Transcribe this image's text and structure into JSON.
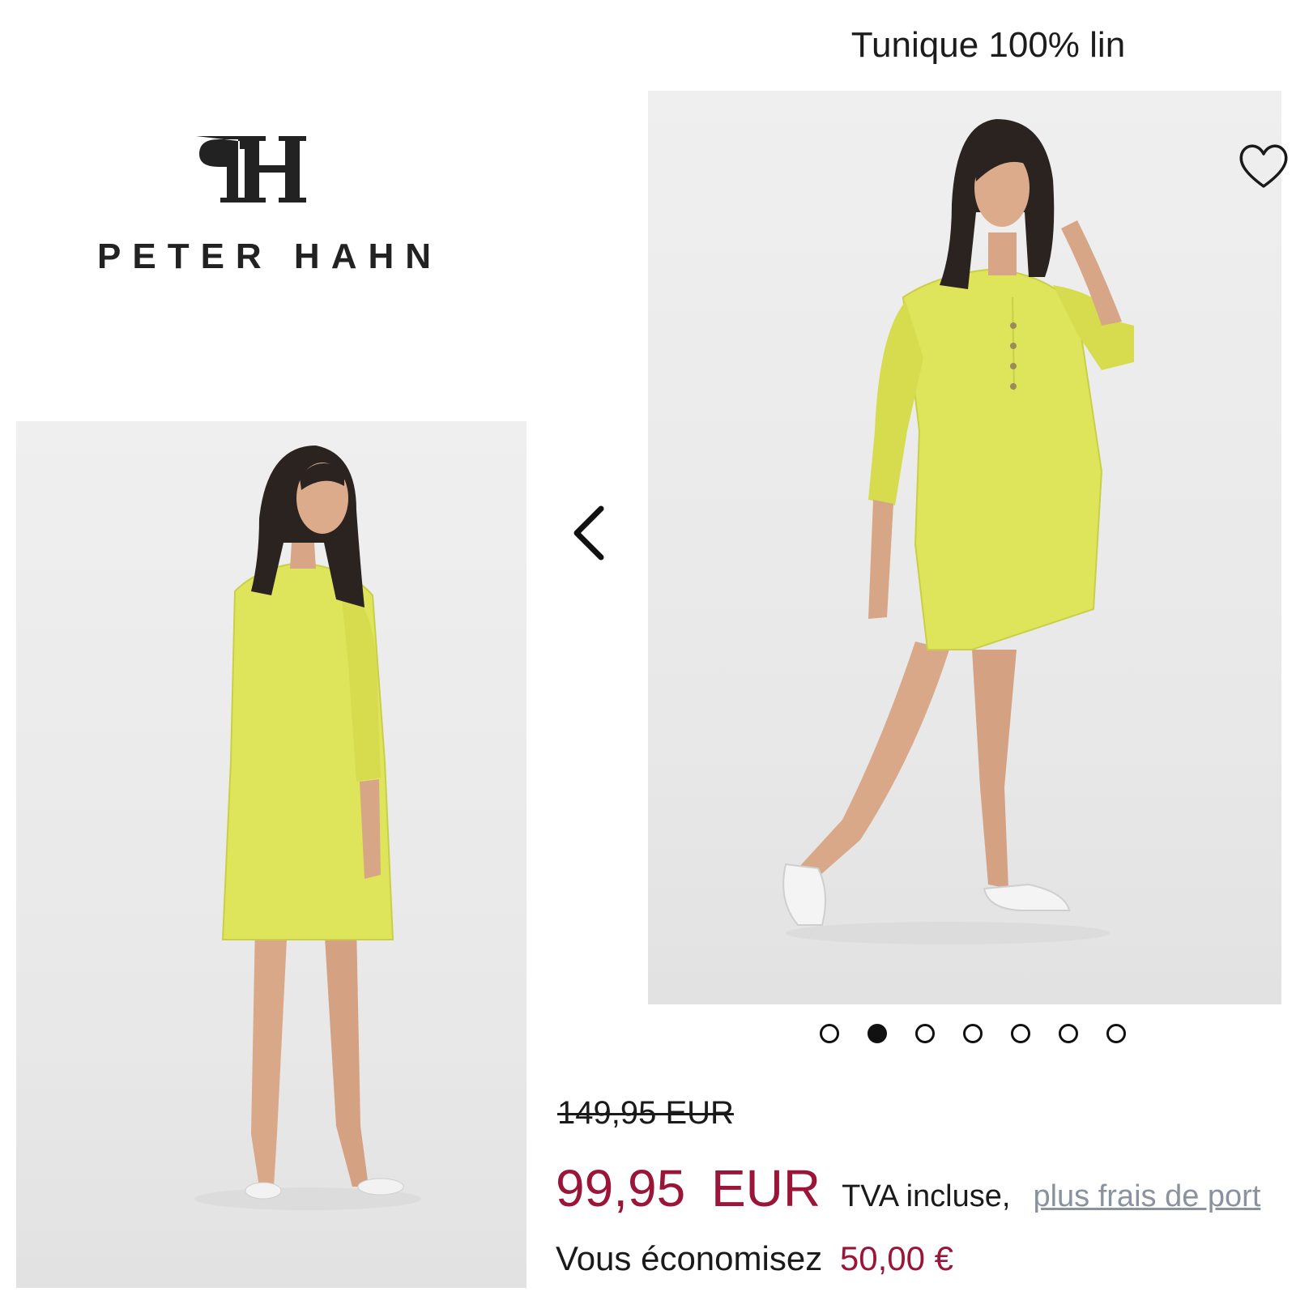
{
  "product": {
    "title": "Tunique 100% lin"
  },
  "brand": {
    "name": "PETER HAHN",
    "monogram": "PH"
  },
  "gallery": {
    "image_count": 7,
    "active_index": 1,
    "prev_icon": "chevron-left-icon",
    "favorite_icon": "heart-outline-icon",
    "colors": {
      "dress": "#dfe55a",
      "background": "#ebebeb"
    }
  },
  "pricing": {
    "old_price": "149,95 EUR",
    "new_price": "99,95 EUR",
    "vat_text": "TVA incluse,",
    "shipping_link": "plus frais de port",
    "savings_label": "Vous économisez",
    "savings_amount": "50,00 €"
  },
  "colors": {
    "price_accent": "#9b1538",
    "link_gray": "#8a929e",
    "text": "#1a1a1a"
  }
}
